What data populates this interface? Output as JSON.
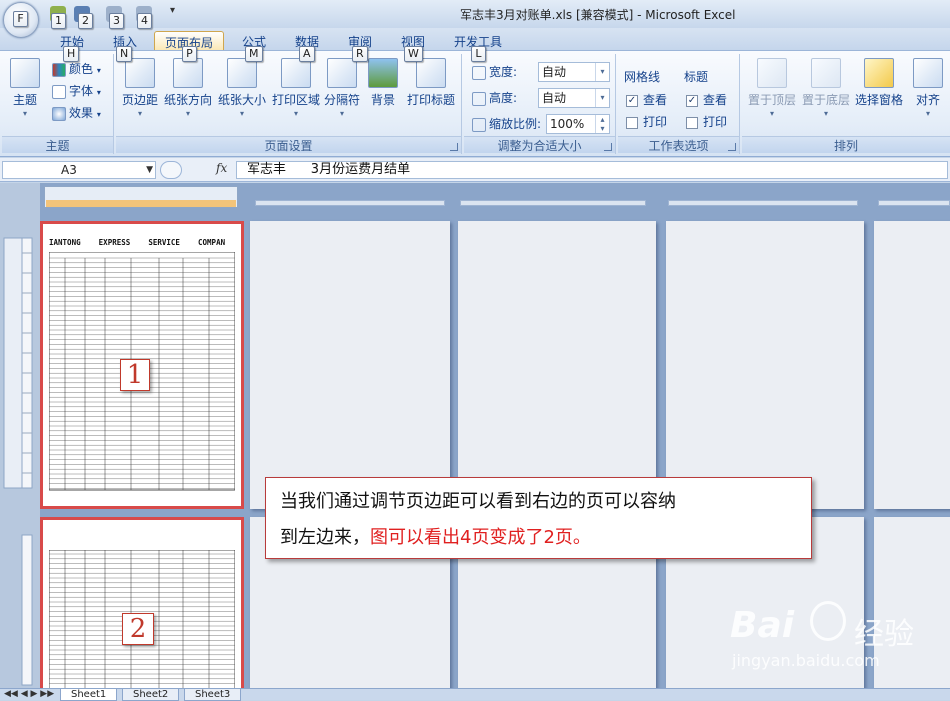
{
  "window": {
    "title": "军志丰3月对账单.xls  [兼容模式] - Microsoft Excel"
  },
  "office_button": {
    "label": "F"
  },
  "qat_keytips": [
    "1",
    "2",
    "3",
    "4"
  ],
  "tabs": [
    {
      "label": "开始",
      "keytip": "H"
    },
    {
      "label": "插入",
      "keytip": "N"
    },
    {
      "label": "页面布局",
      "keytip": "P"
    },
    {
      "label": "公式",
      "keytip": "M"
    },
    {
      "label": "数据",
      "keytip": "A"
    },
    {
      "label": "审阅",
      "keytip": "R"
    },
    {
      "label": "视图",
      "keytip": "W"
    },
    {
      "label": "开发工具",
      "keytip": "L"
    }
  ],
  "ribbon": {
    "theme_group": {
      "label": "主题",
      "big_label": "主题",
      "items": [
        "颜色",
        "字体",
        "效果"
      ]
    },
    "page_setup": {
      "label": "页面设置",
      "buttons": [
        "页边距",
        "纸张方向",
        "纸张大小",
        "打印区域",
        "分隔符",
        "背景",
        "打印标题"
      ]
    },
    "scale_group": {
      "label": "调整为合适大小",
      "width_label": "宽度:",
      "width_value": "自动",
      "height_label": "高度:",
      "height_value": "自动",
      "scale_label": "缩放比例:",
      "scale_value": "100%"
    },
    "sheet_options": {
      "label": "工作表选项",
      "gridlines": "网格线",
      "headings": "标题",
      "view": "查看",
      "print": "打印"
    },
    "arrange": {
      "label": "排列",
      "buttons": [
        "置于顶层",
        "置于底层",
        "选择窗格",
        "对齐"
      ]
    }
  },
  "formula_bar": {
    "name_box": "A3",
    "fx": "fx",
    "content": "军志丰      3月份运费月结单"
  },
  "pages": {
    "page1_header": "IANTONG    EXPRESS    SERVICE    COMPAN",
    "page1_label": "1",
    "page2_label": "2"
  },
  "callout": {
    "line1": "当我们通过调节页边距可以看到右边的页可以容纳",
    "line2_black": "到左边来，",
    "line2_red": "图可以看出4页变成了2页。"
  },
  "sheet_tabs": [
    "Sheet1",
    "Sheet2",
    "Sheet3"
  ],
  "watermark": {
    "brand": "Bai",
    "brand2": "经验",
    "url": "jingyan.baidu.com"
  },
  "colors": {
    "accent_red": "#d84a4a",
    "callout_red": "#e02020",
    "ribbon_blue": "#15428b"
  }
}
